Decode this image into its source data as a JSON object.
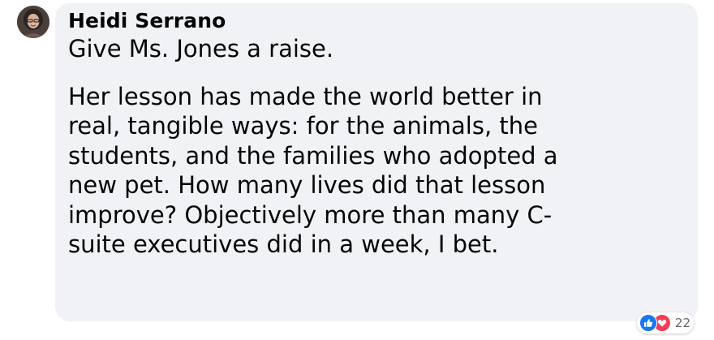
{
  "comment": {
    "author": "Heidi Serrano",
    "paragraphs": [
      "Give Ms. Jones a raise.",
      "Her lesson has made the world better in\nreal, tangible ways: for the animals, the\nstudents, and the families who adopted a\nnew pet. How many lives did that lesson\nimprove? Objectively more than many C-\nsuite executives did in a week, I bet."
    ],
    "reactions": {
      "icons": [
        "like-icon",
        "love-icon"
      ],
      "count": "22"
    }
  },
  "colors": {
    "bubble_background": "#f0f2f5",
    "text": "#050505",
    "like": "#1877f2",
    "love": "#f33e58",
    "count": "#65676b"
  }
}
